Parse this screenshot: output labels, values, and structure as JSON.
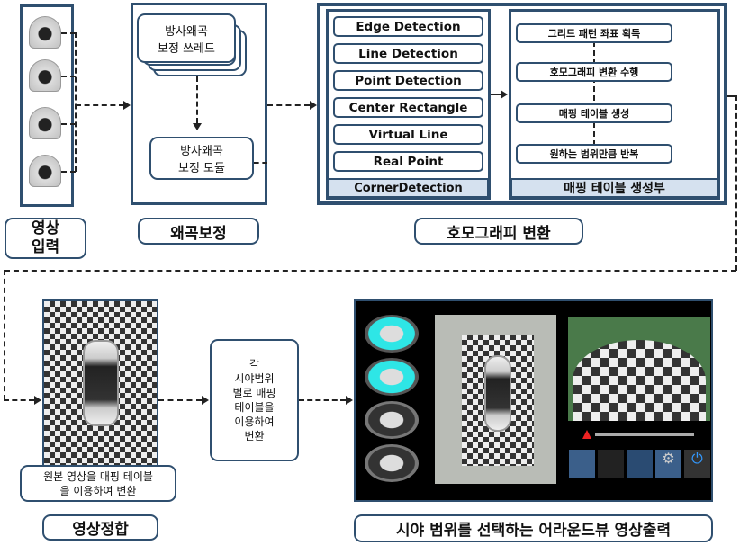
{
  "input": {
    "label": "영상\n입력",
    "cameras": [
      "camera-1",
      "camera-2",
      "camera-3",
      "camera-4"
    ]
  },
  "distortion": {
    "thread": "방사왜곡\n보정 쓰레드",
    "module": "방사왜곡\n보정 모듈",
    "label": "왜곡보정"
  },
  "homography": {
    "corner_items": [
      "Edge Detection",
      "Line Detection",
      "Point Detection",
      "Center Rectangle",
      "Virtual Line",
      "Real Point"
    ],
    "corner_footer": "CornerDetection",
    "mapping_items": [
      "그리드 패턴 좌표 획득",
      "호모그래피 변환 수행",
      "매핑 테이블 생성",
      "원하는 범위만큼 반복"
    ],
    "mapping_footer": "매핑 테이블 생성부",
    "label": "호모그래피 변환"
  },
  "registration": {
    "caption": "원본 영상을 매핑 테이블\n을 이용하여 변환",
    "label": "영상정합"
  },
  "transform": {
    "text": "각\n시야범위\n별로 매핑\n테이블을\n이용하여\n변환"
  },
  "output": {
    "label": "시야 범위를 선택하는 어라운드뷰 영상출력",
    "accent": "#2ee6e6"
  }
}
